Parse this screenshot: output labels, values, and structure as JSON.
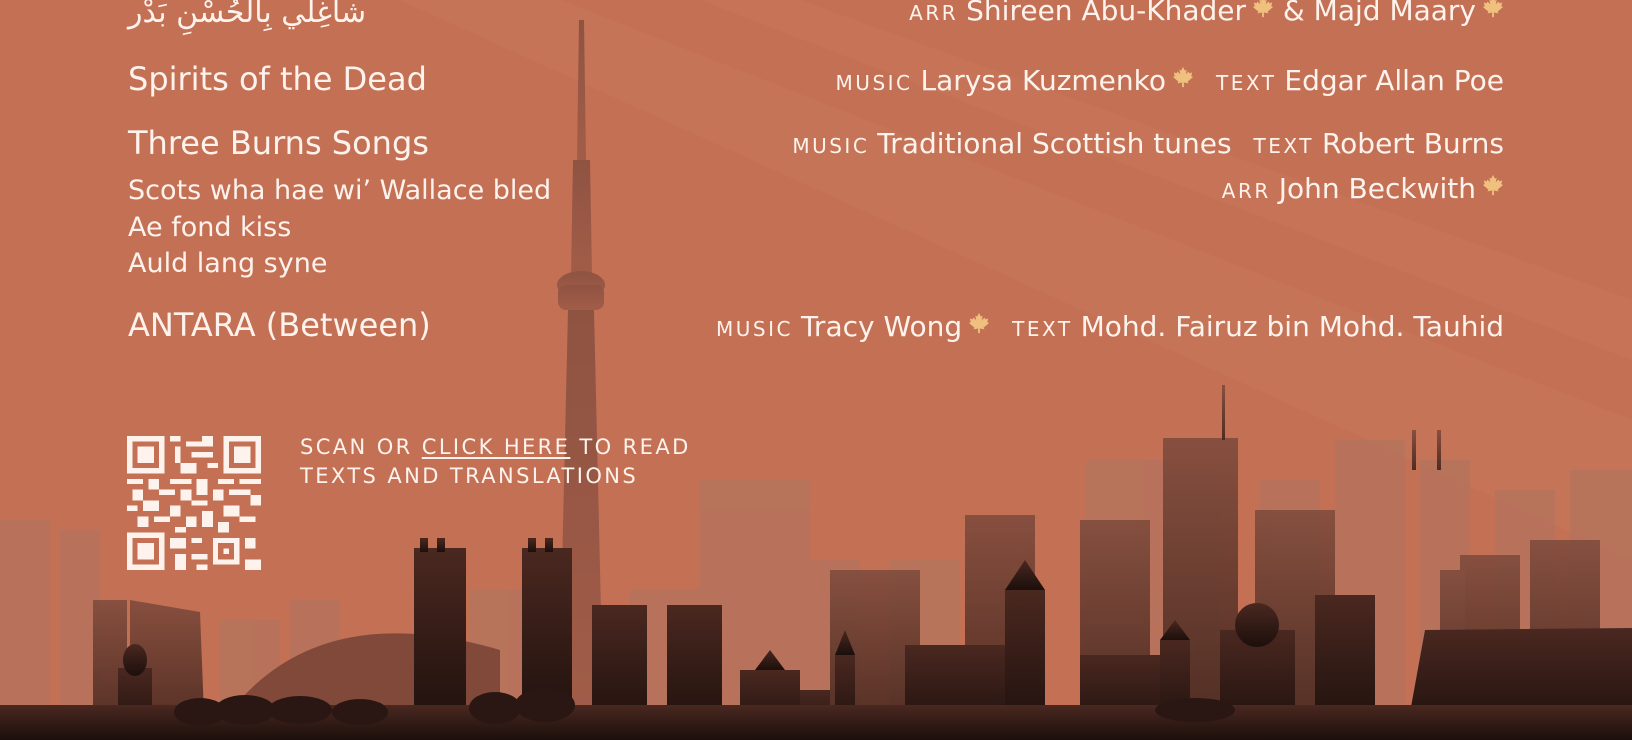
{
  "roles": {
    "arr": "ARR",
    "music": "MUSIC",
    "text": "TEXT"
  },
  "works": [
    {
      "title": "شاغِلي بِالحُسْنِ بَدْر",
      "credits": {
        "arr_name_1": "Shireen Abu-Khader",
        "joiner": "&",
        "arr_name_2": "Majd Maary"
      }
    },
    {
      "title": "Spirits of the Dead",
      "credits": {
        "music": "Larysa Kuzmenko",
        "text": "Edgar Allan Poe"
      }
    },
    {
      "title": "Three Burns Songs",
      "credits": {
        "music": "Traditional Scottish tunes",
        "text": "Robert Burns",
        "arr": "John Beckwith"
      },
      "songs": [
        "Scots wha hae wi’ Wallace bled",
        "Ae fond kiss",
        "Auld lang syne"
      ]
    },
    {
      "title": "ANTARA (Between)",
      "credits": {
        "music": "Tracy Wong",
        "text": "Mohd. Fairuz bin Mohd. Tauhid"
      }
    }
  ],
  "scan": {
    "prefix": "SCAN OR",
    "link": "CLICK HERE",
    "suffix": "TO READ",
    "line2": "TEXTS AND TRANSLATIONS"
  },
  "icons": {
    "canadian": "maple-leaf-icon",
    "qr": "qr-code-icon"
  },
  "colors": {
    "background": "#c47055",
    "text": "#fdf3ec",
    "maple": "#efc07e",
    "skyline_dark": "#2b1814"
  }
}
